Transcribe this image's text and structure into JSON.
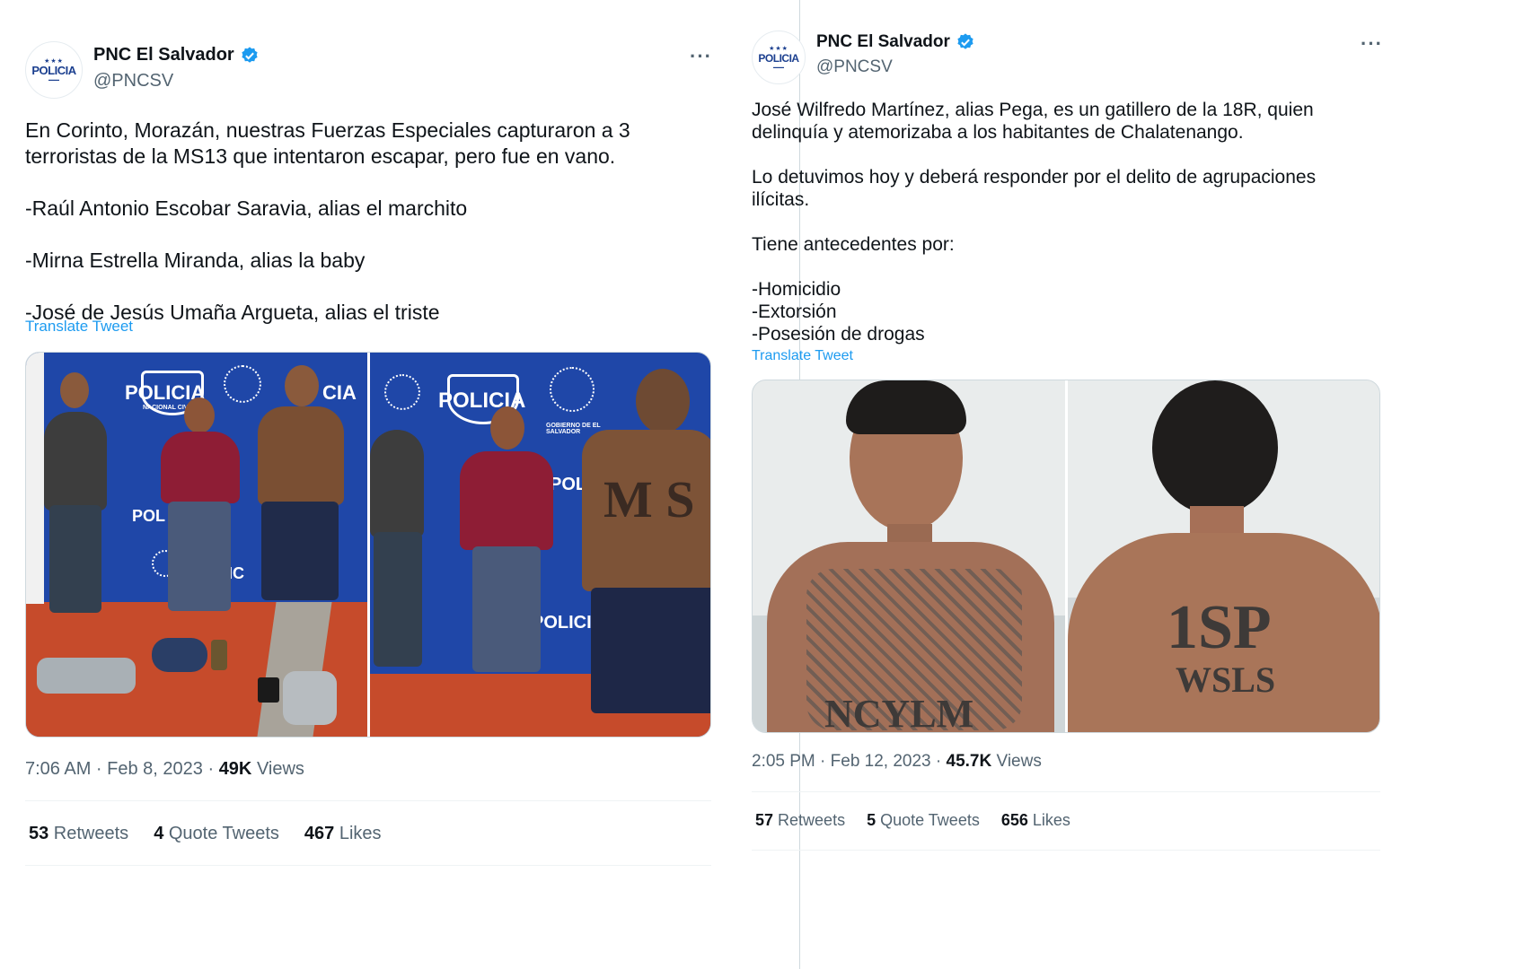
{
  "left_tweet": {
    "avatar_text": "POLICIA",
    "display_name": "PNC El Salvador",
    "handle": "@PNCSV",
    "more": "···",
    "text": "En Corinto, Morazán, nuestras Fuerzas Especiales capturaron a 3 terroristas de la MS13 que intentaron escapar, pero fue en vano.\n\n-Raúl Antonio Escobar Saravia, alias el marchito\n\n-Mirna Estrella Miranda, alias la baby\n\n-José de Jesús Umaña Argueta, alias el triste",
    "translate": "Translate Tweet",
    "time": "7:06 AM · Feb 8, 2023 · ",
    "views_count": "49K",
    "views_label": " Views",
    "retweets_count": "53",
    "retweets_label": " Retweets",
    "quotes_count": "4",
    "quotes_label": " Quote Tweets",
    "likes_count": "467",
    "likes_label": " Likes"
  },
  "right_tweet": {
    "avatar_text": "POLICIA",
    "display_name": "PNC El Salvador",
    "handle": "@PNCSV",
    "more": "···",
    "text": "José Wilfredo Martínez, alias Pega, es un gatillero de la 18R, quien\ndelinquía y atemorizaba a los habitantes de Chalatenango.\n\nLo detuvimos hoy y deberá responder por el delito de agrupaciones\nilícitas.\n\nTiene antecedentes por:\n\n-Homicidio\n-Extorsión\n-Posesión de drogas",
    "translate": "Translate Tweet",
    "time": "2:05 PM · Feb 12, 2023 · ",
    "views_count": "45.7K",
    "views_label": " Views",
    "retweets_count": "57",
    "retweets_label": " Retweets",
    "quotes_count": "5",
    "quotes_label": " Quote Tweets",
    "likes_count": "656",
    "likes_label": " Likes"
  },
  "photo_text": {
    "police": "POLICIA",
    "police_sub": "NACIONAL CIVIL",
    "gov": "GOBIERNO DE EL SALVADOR"
  },
  "colors": {
    "link": "#1d9bf0",
    "verified": "#1d9bf0",
    "police_blue": "#1f47a8",
    "muted": "#536471"
  }
}
